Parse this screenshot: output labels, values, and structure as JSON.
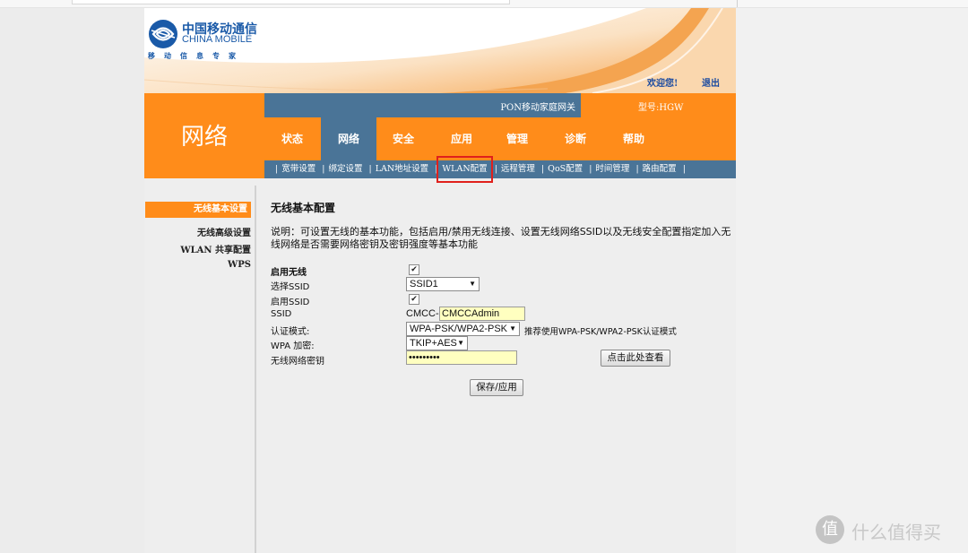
{
  "header": {
    "logo_cn": "中国移动通信",
    "logo_en": "CHINA MOBILE",
    "logo_sub": "移动信息专家",
    "welcome_link": "欢迎您!",
    "logout_link": "退出",
    "gateway_name": "PON移动家庭网关",
    "model_label": "型号:HGW"
  },
  "nav": {
    "section_title": "网络",
    "menu": [
      "状态",
      "网络",
      "安全",
      "应用",
      "管理",
      "诊断",
      "帮助"
    ],
    "active_menu": "网络",
    "submenu": [
      "宽带设置",
      "绑定设置",
      "LAN地址设置",
      "WLAN配置",
      "远程管理",
      "QoS配置",
      "时间管理",
      "路由配置"
    ],
    "highlighted_submenu": "WLAN配置"
  },
  "sidebar": {
    "items": [
      {
        "label": "无线基本设置",
        "active": true
      },
      {
        "label": "无线高级设置",
        "active": false
      },
      {
        "label": "WLAN 共享配置",
        "active": false
      },
      {
        "label": "WPS",
        "active": false
      }
    ]
  },
  "content": {
    "title": "无线基本配置",
    "description": "说明：可设置无线的基本功能，包括启用/禁用无线连接、设置无线网络SSID以及无线安全配置指定加入无线网络是否需要网络密钥及密钥强度等基本功能",
    "form": {
      "enable_wireless_label": "启用无线",
      "enable_wireless_checked": true,
      "select_ssid_label": "选择SSID",
      "select_ssid_value": "SSID1",
      "enable_ssid_label": "启用SSID",
      "enable_ssid_checked": true,
      "ssid_label": "SSID",
      "ssid_prefix": "CMCC-",
      "ssid_value": "CMCCAdmin",
      "auth_mode_label": "认证模式:",
      "auth_mode_value": "WPA-PSK/WPA2-PSK",
      "auth_mode_hint": "推荐使用WPA-PSK/WPA2-PSK认证模式",
      "wpa_encrypt_label": "WPA 加密:",
      "wpa_encrypt_value": "TKIP+AES",
      "password_label": "无线网络密钥",
      "password_value": "•••••••••",
      "show_password_button": "点击此处查看",
      "save_button": "保存/应用"
    }
  },
  "watermark": {
    "icon_text": "值",
    "text": "什么值得买"
  },
  "colors": {
    "orange": "#ff8c1a",
    "steel_blue": "#4a7497",
    "logo_blue": "#1a5aa8",
    "highlight_red": "#e0201c",
    "input_yellow": "#ffffc0"
  }
}
